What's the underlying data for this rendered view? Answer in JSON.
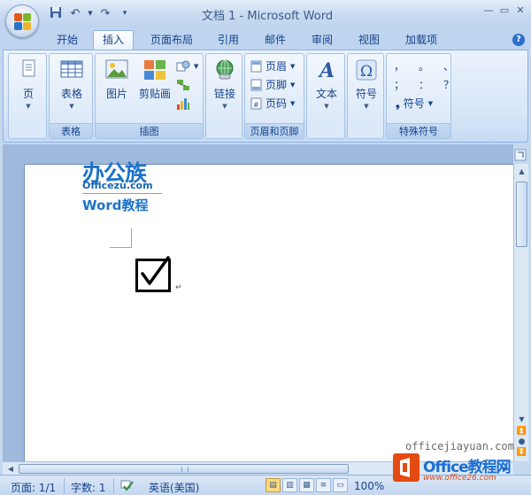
{
  "title_bar": {
    "title": "文档 1 - Microsoft Word",
    "qat_icons": [
      "save-icon",
      "undo-icon",
      "redo-icon",
      "customize-icon"
    ],
    "window_controls": [
      "minimize-icon",
      "restore-icon",
      "close-icon"
    ]
  },
  "tabs": [
    {
      "label": "开始",
      "active": false
    },
    {
      "label": "插入",
      "active": true
    },
    {
      "label": "页面布局",
      "active": false
    },
    {
      "label": "引用",
      "active": false
    },
    {
      "label": "邮件",
      "active": false
    },
    {
      "label": "审阅",
      "active": false
    },
    {
      "label": "视图",
      "active": false
    },
    {
      "label": "加载项",
      "active": false
    }
  ],
  "ribbon": {
    "page_group": {
      "button": "页"
    },
    "table_group": {
      "label": "表格",
      "button": "表格"
    },
    "illustration_group": {
      "label": "插图",
      "picture": "图片",
      "clipart": "剪贴画"
    },
    "link_group": {
      "button": "链接"
    },
    "header_footer_group": {
      "label": "页眉和页脚",
      "header": "页眉",
      "footer": "页脚",
      "page_number": "页码"
    },
    "text_group": {
      "button": "文本"
    },
    "symbol_group": {
      "button": "符号"
    },
    "special_symbols_group": {
      "label": "特殊符号",
      "row1": [
        "，",
        "。",
        "、"
      ],
      "row2": [
        "；",
        "：",
        "？"
      ],
      "symbol_button": "符号"
    }
  },
  "document": {
    "logo": {
      "main": "办公族",
      "sub": "Officezu.com",
      "word": "Word教程"
    },
    "checkbox_symbol": "☑",
    "paragraph_mark": "↵"
  },
  "status_bar": {
    "page": "页面: 1/1",
    "word_count": "字数: 1",
    "language": "英语(美国)",
    "zoom": "100%"
  },
  "watermark": {
    "url_text": "officejiayuan.com",
    "brand": "Office教程网",
    "brand_url": "www.office26.com"
  },
  "colors": {
    "accent": "#15428b",
    "ribbon_bg": "#dce9f8",
    "active_tab": "#ffffff",
    "logo_blue": "#1c73c9",
    "brand_orange": "#e44b12"
  }
}
